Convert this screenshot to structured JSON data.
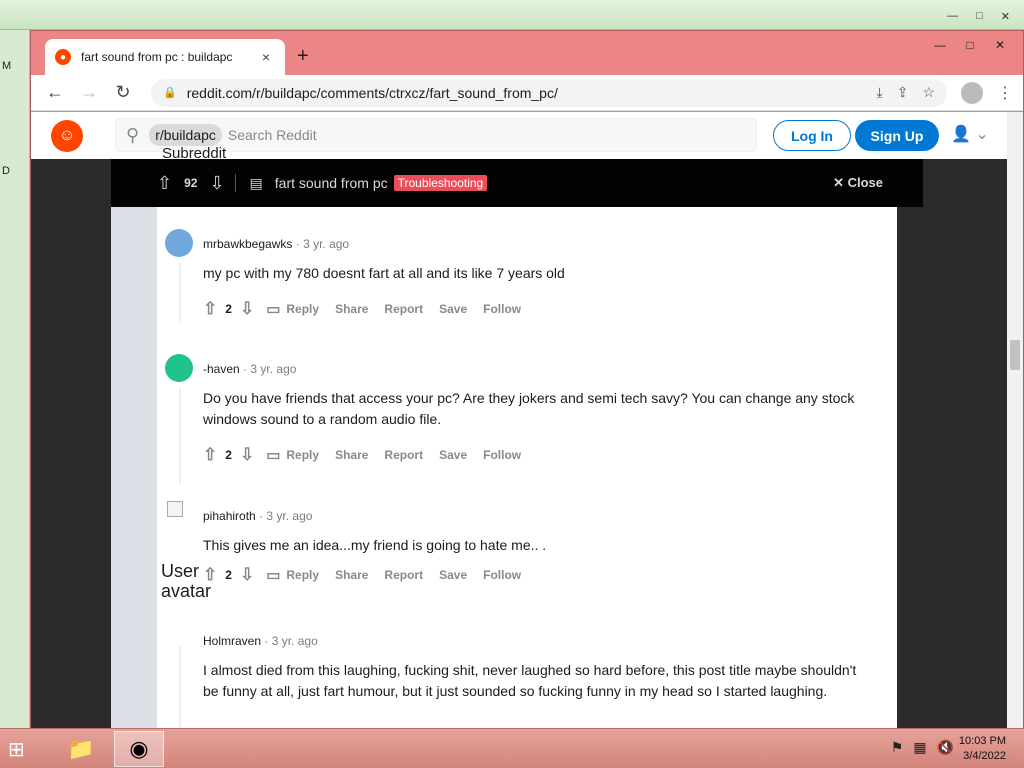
{
  "desktop": {
    "left_labels": [
      "M",
      "D"
    ]
  },
  "browser": {
    "tab": {
      "title": "fart sound from pc : buildapc",
      "close": "×"
    },
    "new_tab": "+",
    "url": "reddit.com/r/buildapc/comments/ctrxcz/fart_sound_from_pc/",
    "window_controls": [
      "—",
      "□",
      "✕"
    ]
  },
  "reddit": {
    "search": {
      "subreddit_chip": "r/buildapc",
      "chip_alt": "Subreddit",
      "placeholder": "Search Reddit"
    },
    "login_label": "Log In",
    "signup_label": "Sign Up",
    "postbar": {
      "votes": "92",
      "title": "fart sound from pc",
      "flair": "Troubleshooting",
      "close_label": "Close"
    },
    "comments": [
      {
        "author": "mrbawkbegawks",
        "time": "3 yr. ago",
        "body": "my pc with my 780 doesnt fart at all and its like 7 years old",
        "score": "2"
      },
      {
        "author": "-haven",
        "time": "3 yr. ago",
        "body": "Do you have friends that access your pc? Are they jokers and semi tech savy? You can change any stock windows sound to a random audio file.",
        "score": "2"
      },
      {
        "author": "pihahiroth",
        "time": "3 yr. ago",
        "body": "This gives me an idea...my friend is going to hate me.. .",
        "score": "2"
      },
      {
        "author": "Holmraven",
        "time": "3 yr. ago",
        "body": "I almost died from this laughing, fucking shit, never laughed so hard before, this post title maybe shouldn't be funny at all, just fart humour, but it just sounded so fucking funny in my head so I started laughing.",
        "score": ""
      }
    ],
    "actions": {
      "reply": "Reply",
      "share": "Share",
      "report": "Report",
      "save": "Save",
      "follow": "Follow"
    },
    "user_avatar_alt": "User avatar"
  },
  "taskbar": {
    "time": "10:03 PM",
    "date": "3/4/2022"
  },
  "colors": {
    "accent": "#0079d3",
    "brand": "#ff4500",
    "flair": "#ea4e5a",
    "window_frame": "#e98383"
  }
}
